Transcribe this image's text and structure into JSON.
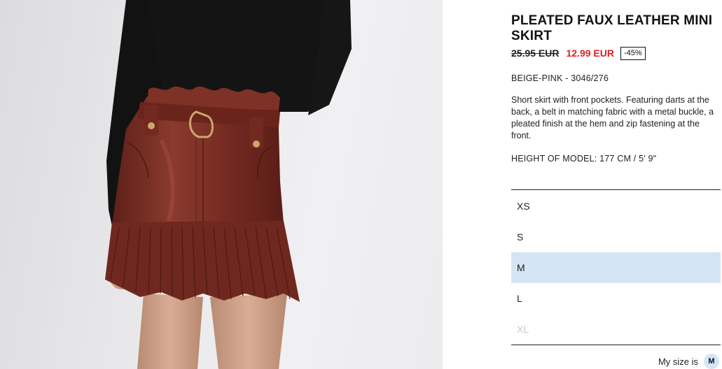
{
  "product": {
    "image_alt": "Model wearing pleated faux leather mini skirt",
    "title": "PLEATED FAUX LEATHER MINI SKIRT",
    "price": {
      "original": "25.95 EUR",
      "sale": "12.99 EUR",
      "discount": "-45%"
    },
    "color_ref": "BEIGE-PINK - 3046/276",
    "description": "Short skirt with front pockets. Featuring darts at the back, a belt in matching fabric with a metal buckle, a pleated finish at the hem and zip fastening at the front.",
    "model_height": "HEIGHT OF MODEL: 177 CM / 5′ 9″"
  },
  "sizes": [
    {
      "label": "XS",
      "state": "available"
    },
    {
      "label": "S",
      "state": "available"
    },
    {
      "label": "M",
      "state": "selected"
    },
    {
      "label": "L",
      "state": "available"
    },
    {
      "label": "XL",
      "state": "unavailable"
    }
  ],
  "my_size": {
    "label": "My size is",
    "value": "M"
  },
  "colors": {
    "sale_price": "#e02020",
    "selected_bg": "#d6e5f5",
    "skirt": "#7a2e24",
    "sweater": "#111111"
  }
}
